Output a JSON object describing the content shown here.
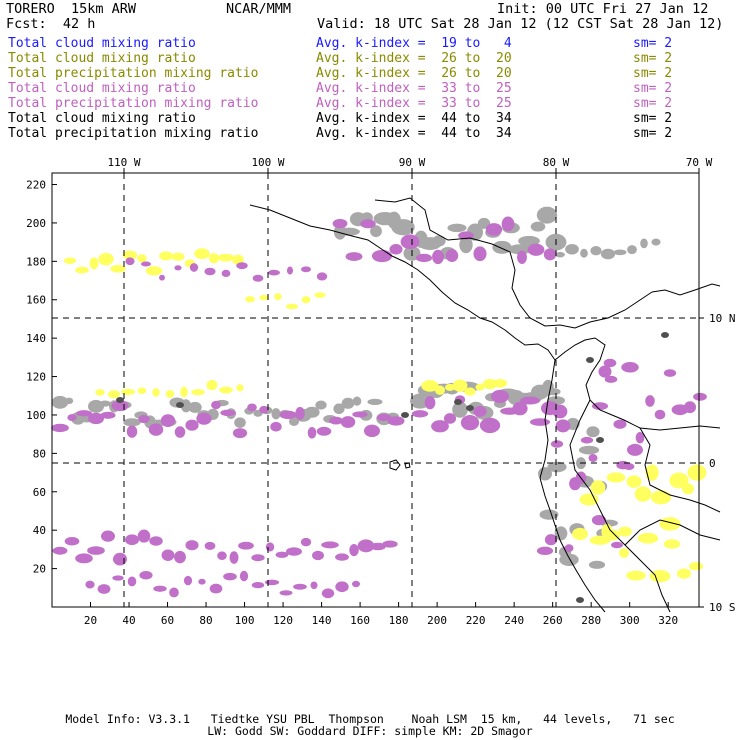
{
  "header": {
    "title_left": "TORERO  15km ARW",
    "org": "NCAR/MMM",
    "init": "Init: 00 UTC Fri 27 Jan 12",
    "fcst": "Fcst:  42 h",
    "valid": "Valid: 18 UTC Sat 28 Jan 12 (12 CST Sat 28 Jan 12)"
  },
  "legend": [
    {
      "var": "Total cloud mixing ratio",
      "kindex": "Avg. k-index =  19 to   4",
      "sm": "sm= 2",
      "color": "#1a1aff"
    },
    {
      "var": "Total cloud mixing ratio",
      "kindex": "Avg. k-index =  26 to  20",
      "sm": "sm= 2",
      "color": "#8a8a00"
    },
    {
      "var": "Total precipitation mixing ratio",
      "kindex": "Avg. k-index =  26 to  20",
      "sm": "sm= 2",
      "color": "#8a8a00"
    },
    {
      "var": "Total cloud mixing ratio",
      "kindex": "Avg. k-index =  33 to  25",
      "sm": "sm= 2",
      "color": "#c060c0"
    },
    {
      "var": "Total precipitation mixing ratio",
      "kindex": "Avg. k-index =  33 to  25",
      "sm": "sm= 2",
      "color": "#c060c0"
    },
    {
      "var": "Total cloud mixing ratio",
      "kindex": "Avg. k-index =  44 to  34",
      "sm": "sm= 2",
      "color": "#000000"
    },
    {
      "var": "Total precipitation mixing ratio",
      "kindex": "Avg. k-index =  44 to  34",
      "sm": "sm= 2",
      "color": "#000000"
    }
  ],
  "map": {
    "lon_labels": [
      "110 W",
      "100 W",
      "90 W",
      "80 W",
      "70 W"
    ],
    "lat_labels": [
      "10 N",
      "0",
      "10 S"
    ],
    "x_ticks": [
      "20",
      "40",
      "60",
      "80",
      "100",
      "120",
      "140",
      "160",
      "180",
      "200",
      "220",
      "240",
      "260",
      "280",
      "300",
      "320"
    ],
    "y_ticks": [
      "220",
      "200",
      "180",
      "160",
      "140",
      "120",
      "100",
      "80",
      "60",
      "40",
      "20"
    ],
    "colors": {
      "gray": "#a8a8a8",
      "yellow": "#ffff60",
      "purple": "#c070c8",
      "dark": "#505050",
      "coast": "#000000"
    }
  },
  "footer": {
    "line1": "Model Info: V3.3.1   Tiedtke YSU PBL  Thompson    Noah LSM  15 km,   44 levels,   71 sec",
    "line2": "LW: Godd SW: Goddard DIFF: simple KM: 2D Smagor"
  }
}
